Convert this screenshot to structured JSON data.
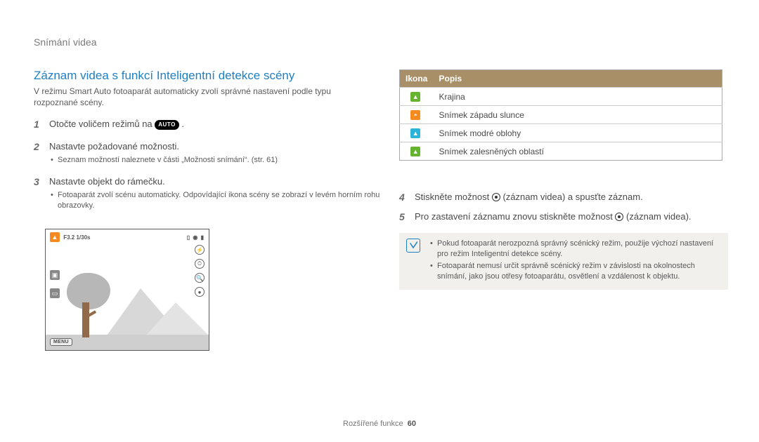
{
  "header": {
    "breadcrumb": "Snímání videa"
  },
  "title": "Záznam videa s funkcí Inteligentní detekce scény",
  "intro": "V režimu Smart Auto fotoaparát automaticky zvolí správné nastavení podle typu rozpoznané scény.",
  "steps": {
    "s1_num": "1",
    "s1_text_pre": "Otočte voličem režimů na ",
    "s1_auto_label": "AUTO",
    "s1_text_post": " .",
    "s2_num": "2",
    "s2_text": "Nastavte požadované možnosti.",
    "s2_sub": "Seznam možností naleznete v části „Možnosti snímání“. (str. 61)",
    "s3_num": "3",
    "s3_text": "Nastavte objekt do rámečku.",
    "s3_sub": "Fotoaparát zvolí scénu automaticky. Odpovídající ikona scény se zobrazí v levém horním rohu obrazovky.",
    "s4_num": "4",
    "s4_text_pre": "Stiskněte možnost ",
    "s4_text_mid": " (záznam videa) a spusťte záznam.",
    "s5_num": "5",
    "s5_text_pre": "Pro zastavení záznamu znovu stiskněte možnost ",
    "s5_text_mid": " (záznam videa)."
  },
  "preview": {
    "exposure_text": "F3.2 1/30s",
    "menu_label": "MENU"
  },
  "table": {
    "col_icon": "Ikona",
    "col_desc": "Popis",
    "rows": [
      {
        "icon_name": "landscape-icon",
        "icon_class": "col-green",
        "glyph": "▲",
        "desc": "Krajina"
      },
      {
        "icon_name": "sunset-icon",
        "icon_class": "col-orange",
        "glyph": "◓",
        "desc": "Snímek západu slunce"
      },
      {
        "icon_name": "blue-sky-icon",
        "icon_class": "col-cyan",
        "glyph": "▲",
        "desc": "Snímek modré oblohy"
      },
      {
        "icon_name": "forest-icon",
        "icon_class": "col-green",
        "glyph": "▲",
        "desc": "Snímek zalesněných oblastí"
      }
    ]
  },
  "notes": {
    "n1": "Pokud fotoaparát nerozpozná správný scénický režim, použije výchozí nastavení pro režim Inteligentní detekce scény.",
    "n2": "Fotoaparát nemusí určit správně scénický režim v závislosti na okolnostech snímání, jako jsou otřesy fotoaparátu, osvětlení a vzdálenost k objektu."
  },
  "footer": {
    "section": "Rozšířené funkce",
    "page": "60"
  }
}
